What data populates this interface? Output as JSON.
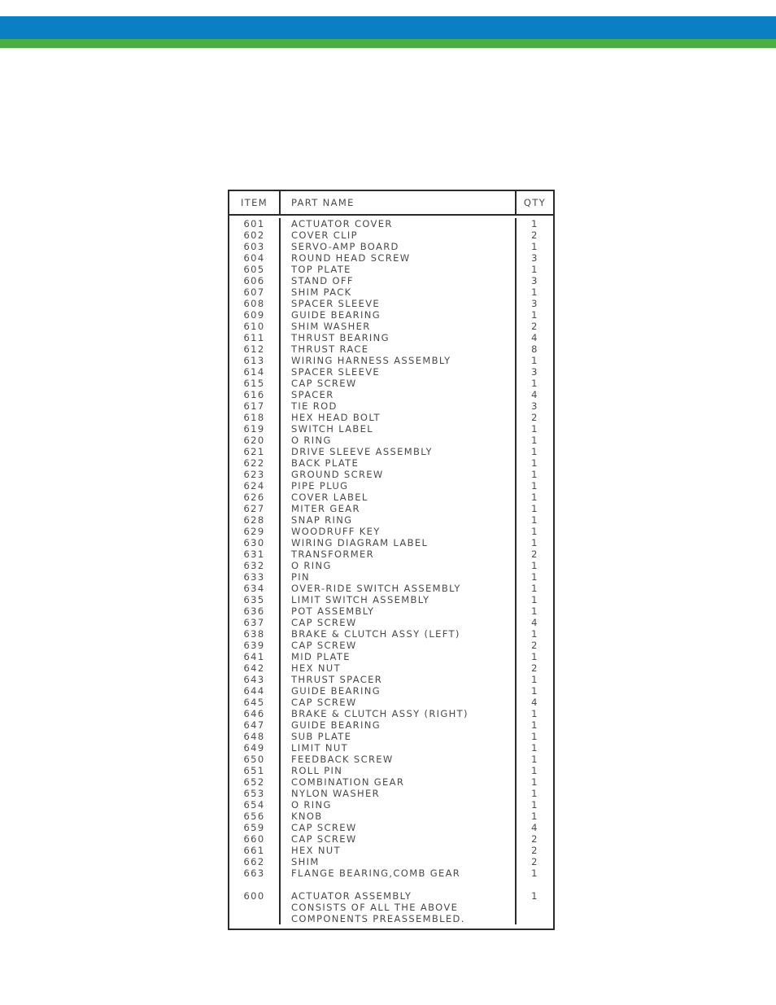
{
  "banner": {
    "blue_color": "#0b7fc4",
    "green_color": "#4caf43"
  },
  "parts_list": {
    "columns": {
      "item": "ITEM",
      "part_name": "PART NAME",
      "qty": "QTY"
    },
    "rows": [
      {
        "item": "601",
        "name": "ACTUATOR COVER",
        "qty": "1"
      },
      {
        "item": "602",
        "name": "COVER CLIP",
        "qty": "2"
      },
      {
        "item": "603",
        "name": "SERVO-AMP BOARD",
        "qty": "1"
      },
      {
        "item": "604",
        "name": "ROUND HEAD SCREW",
        "qty": "3"
      },
      {
        "item": "605",
        "name": "TOP PLATE",
        "qty": "1"
      },
      {
        "item": "606",
        "name": "STAND OFF",
        "qty": "3"
      },
      {
        "item": "607",
        "name": "SHIM PACK",
        "qty": "1"
      },
      {
        "item": "608",
        "name": "SPACER SLEEVE",
        "qty": "3"
      },
      {
        "item": "609",
        "name": "GUIDE BEARING",
        "qty": "1"
      },
      {
        "item": "610",
        "name": "SHIM WASHER",
        "qty": "2"
      },
      {
        "item": "611",
        "name": "THRUST BEARING",
        "qty": "4"
      },
      {
        "item": "612",
        "name": "THRUST RACE",
        "qty": "8"
      },
      {
        "item": "613",
        "name": "WIRING HARNESS ASSEMBLY",
        "qty": "1"
      },
      {
        "item": "614",
        "name": "SPACER SLEEVE",
        "qty": "3"
      },
      {
        "item": "615",
        "name": "CAP SCREW",
        "qty": "1"
      },
      {
        "item": "616",
        "name": "SPACER",
        "qty": "4"
      },
      {
        "item": "617",
        "name": "TIE ROD",
        "qty": "3"
      },
      {
        "item": "618",
        "name": "HEX HEAD BOLT",
        "qty": "2"
      },
      {
        "item": "619",
        "name": "SWITCH LABEL",
        "qty": "1"
      },
      {
        "item": "620",
        "name": "O RING",
        "qty": "1"
      },
      {
        "item": "621",
        "name": "DRIVE SLEEVE ASSEMBLY",
        "qty": "1"
      },
      {
        "item": "622",
        "name": "BACK PLATE",
        "qty": "1"
      },
      {
        "item": "623",
        "name": "GROUND SCREW",
        "qty": "1"
      },
      {
        "item": "624",
        "name": "PIPE PLUG",
        "qty": "1"
      },
      {
        "item": "626",
        "name": "COVER LABEL",
        "qty": "1"
      },
      {
        "item": "627",
        "name": "MITER GEAR",
        "qty": "1"
      },
      {
        "item": "628",
        "name": "SNAP RING",
        "qty": "1"
      },
      {
        "item": "629",
        "name": "WOODRUFF KEY",
        "qty": "1"
      },
      {
        "item": "630",
        "name": "WIRING DIAGRAM LABEL",
        "qty": "1"
      },
      {
        "item": "631",
        "name": "TRANSFORMER",
        "qty": "2"
      },
      {
        "item": "632",
        "name": "O RING",
        "qty": "1"
      },
      {
        "item": "633",
        "name": "PIN",
        "qty": "1"
      },
      {
        "item": "634",
        "name": "OVER-RIDE SWITCH ASSEMBLY",
        "qty": "1"
      },
      {
        "item": "635",
        "name": "LIMIT SWITCH ASSEMBLY",
        "qty": "1"
      },
      {
        "item": "636",
        "name": "POT ASSEMBLY",
        "qty": "1"
      },
      {
        "item": "637",
        "name": "CAP SCREW",
        "qty": "4"
      },
      {
        "item": "638",
        "name": "BRAKE & CLUTCH ASSY (LEFT)",
        "qty": "1"
      },
      {
        "item": "639",
        "name": "CAP SCREW",
        "qty": "2"
      },
      {
        "item": "641",
        "name": "MID PLATE",
        "qty": "1"
      },
      {
        "item": "642",
        "name": "HEX NUT",
        "qty": "2"
      },
      {
        "item": "643",
        "name": "THRUST SPACER",
        "qty": "1"
      },
      {
        "item": "644",
        "name": "GUIDE BEARING",
        "qty": "1"
      },
      {
        "item": "645",
        "name": "CAP SCREW",
        "qty": "4"
      },
      {
        "item": "646",
        "name": "BRAKE & CLUTCH ASSY (RIGHT)",
        "qty": "1"
      },
      {
        "item": "647",
        "name": "GUIDE BEARING",
        "qty": "1"
      },
      {
        "item": "648",
        "name": "SUB PLATE",
        "qty": "1"
      },
      {
        "item": "649",
        "name": "LIMIT NUT",
        "qty": "1"
      },
      {
        "item": "650",
        "name": "FEEDBACK SCREW",
        "qty": "1"
      },
      {
        "item": "651",
        "name": "ROLL PIN",
        "qty": "1"
      },
      {
        "item": "652",
        "name": "COMBINATION GEAR",
        "qty": "1"
      },
      {
        "item": "653",
        "name": "NYLON WASHER",
        "qty": "1"
      },
      {
        "item": "654",
        "name": "O RING",
        "qty": "1"
      },
      {
        "item": "656",
        "name": "KNOB",
        "qty": "1"
      },
      {
        "item": "659",
        "name": "CAP SCREW",
        "qty": "4"
      },
      {
        "item": "660",
        "name": "CAP SCREW",
        "qty": "2"
      },
      {
        "item": "661",
        "name": "HEX NUT",
        "qty": "2"
      },
      {
        "item": "662",
        "name": "SHIM",
        "qty": "2"
      },
      {
        "item": "663",
        "name": "FLANGE BEARING,COMB GEAR",
        "qty": "1"
      },
      {
        "item": "",
        "name": "",
        "qty": ""
      },
      {
        "item": "600",
        "name": "ACTUATOR ASSEMBLY",
        "qty": "1"
      },
      {
        "item": "",
        "name": "CONSISTS OF ALL THE ABOVE",
        "qty": ""
      },
      {
        "item": "",
        "name": "COMPONENTS PREASSEMBLED.",
        "qty": ""
      }
    ]
  }
}
